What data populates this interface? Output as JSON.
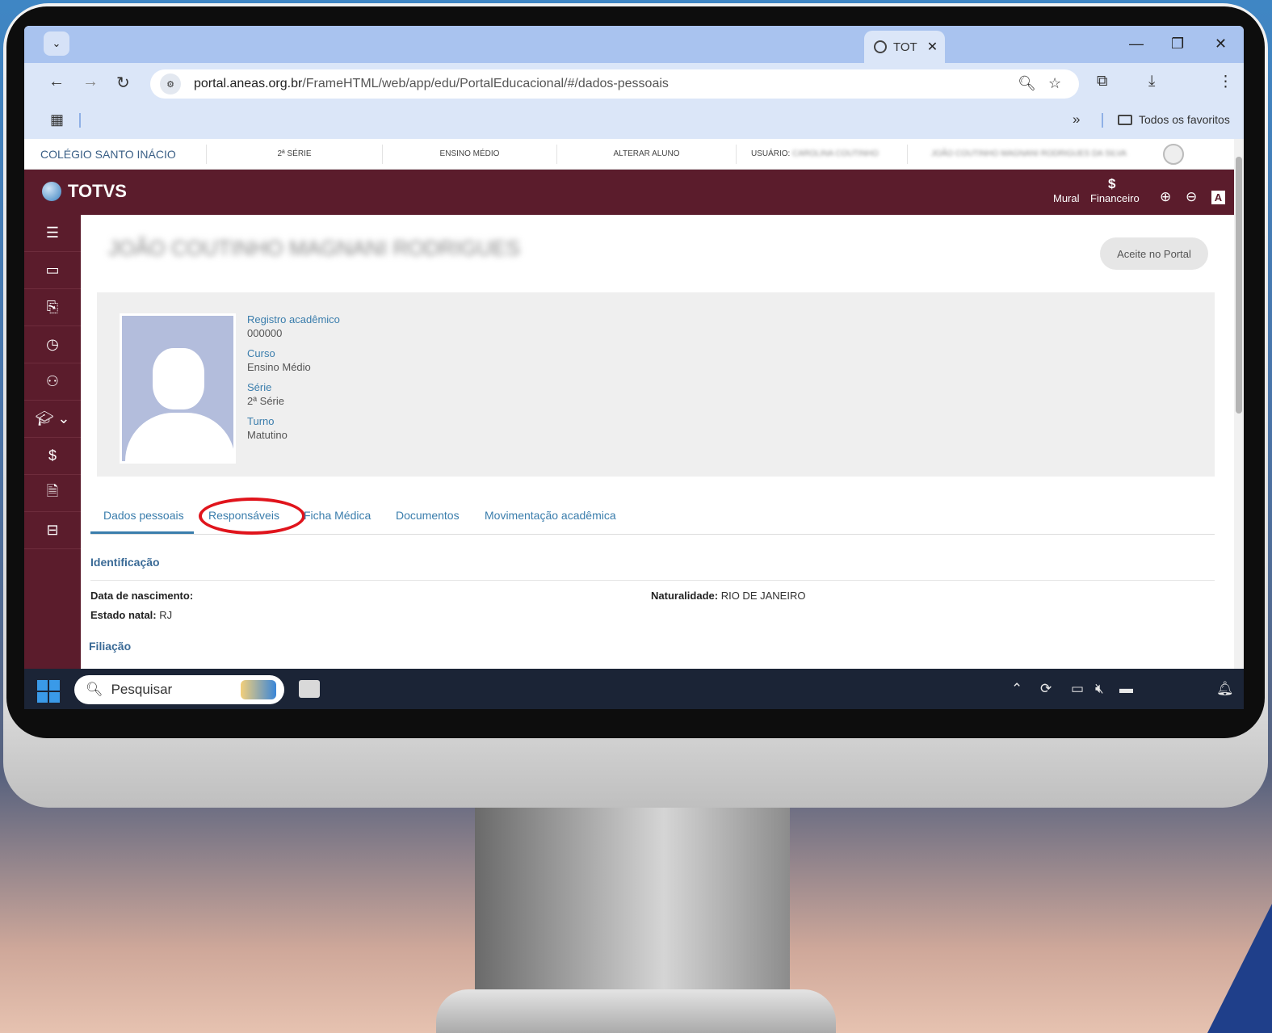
{
  "browser": {
    "tab_title": "TOT",
    "url_host": "portal.aneas.org.br",
    "url_path": "/FrameHTML/web/app/edu/PortalEducacional/#/dados-pessoais",
    "bookmarks_more": "»",
    "bookmarks_folder": "Todos os favoritos"
  },
  "portal_top": {
    "school": "COLÉGIO SANTO INÁCIO",
    "serie": "2ª SÉRIE",
    "nivel": "ENSINO MÉDIO",
    "alterar": "ALTERAR ALUNO",
    "usuario_label": "USUÁRIO:",
    "usuario_value": "CAROLINA COUTINHO",
    "aluno_value": "JOÃO COUTINHO MAGNANI RODRIGUES DA SILVA"
  },
  "header": {
    "logo": "TOTVS",
    "mural": "Mural",
    "dollar": "$",
    "financeiro": "Financeiro",
    "a_label": "A"
  },
  "student": {
    "name": "JOÃO COUTINHO MAGNANI RODRIGUES",
    "aceite_button": "Aceite no Portal",
    "fields": [
      {
        "label": "Registro acadêmico",
        "value": "000000"
      },
      {
        "label": "Curso",
        "value": "Ensino Médio"
      },
      {
        "label": "Série",
        "value": "2ª Série"
      },
      {
        "label": "Turno",
        "value": "Matutino"
      }
    ]
  },
  "tabs": [
    "Dados pessoais",
    "Responsáveis",
    "Ficha Médica",
    "Documentos",
    "Movimentação acadêmica"
  ],
  "identificacao": {
    "title": "Identificação",
    "data_nasc_label": "Data de nascimento:",
    "data_nasc_value": "",
    "naturalidade_label": "Naturalidade:",
    "naturalidade_value": "RIO DE JANEIRO",
    "estado_label": "Estado natal:",
    "estado_value": "RJ"
  },
  "filiacao": {
    "title": "Filiação"
  },
  "taskbar": {
    "search_placeholder": "Pesquisar"
  },
  "colors": {
    "brand": "#5b1c2c",
    "link": "#3a7dac",
    "highlight": "#e0141c"
  }
}
